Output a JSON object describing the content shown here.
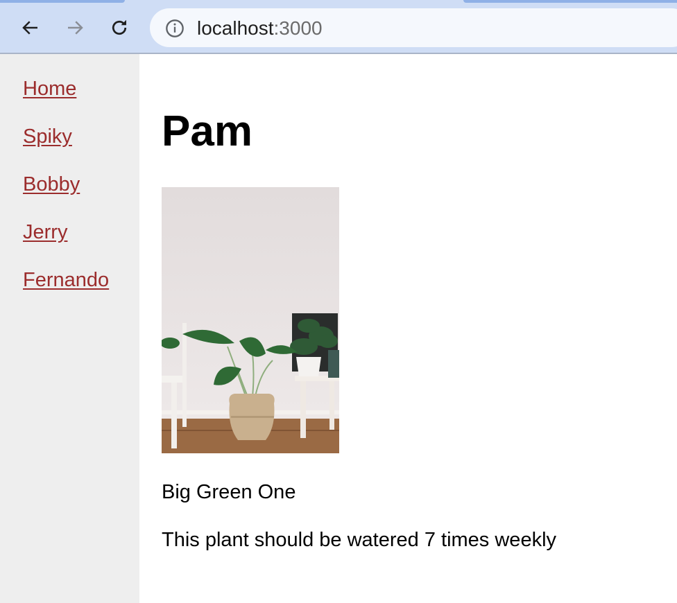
{
  "browser": {
    "url_host": "localhost",
    "url_port": ":3000",
    "icons": {
      "back": "arrow-left-icon",
      "forward": "arrow-right-icon",
      "reload": "reload-icon",
      "site_info": "info-icon"
    }
  },
  "sidebar": {
    "links": [
      {
        "label": "Home"
      },
      {
        "label": "Spiky"
      },
      {
        "label": "Bobby"
      },
      {
        "label": "Jerry"
      },
      {
        "label": "Fernando"
      }
    ],
    "link_color": "#9b2c2c"
  },
  "plant": {
    "name": "Pam",
    "description": "Big Green One",
    "watering": "This plant should be watered 7 times weekly"
  }
}
